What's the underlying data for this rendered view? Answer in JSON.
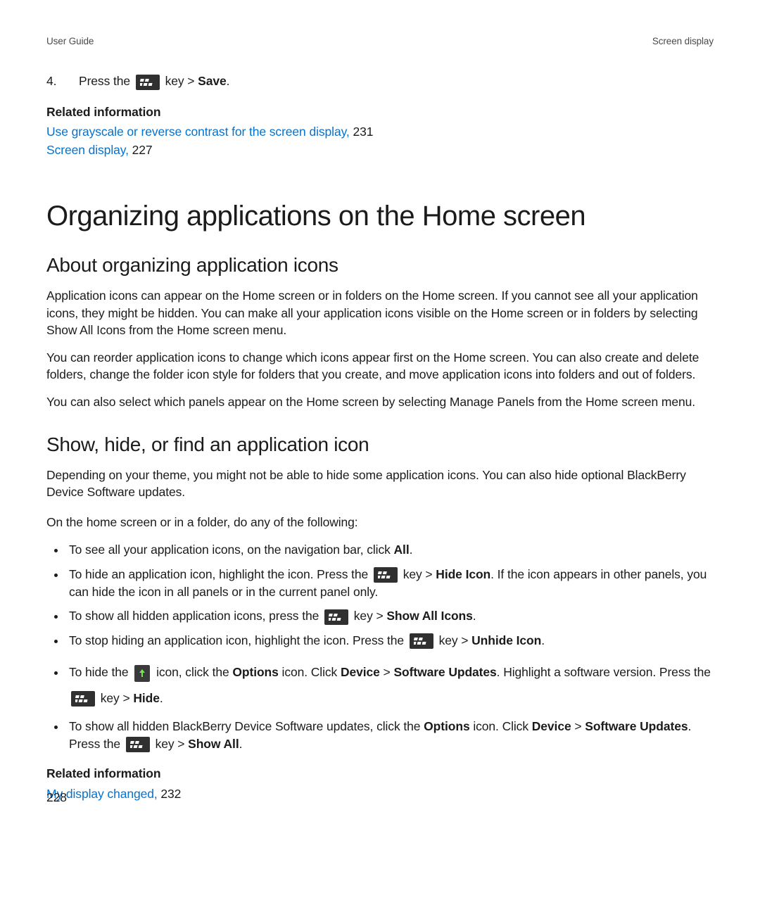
{
  "header": {
    "left": "User Guide",
    "right": "Screen display"
  },
  "step": {
    "number": "4.",
    "text_before_key": "Press the ",
    "text_after_key_prefix": " key > ",
    "bold": "Save",
    "period": "."
  },
  "related1": {
    "heading": "Related information",
    "links": [
      {
        "text": "Use grayscale or reverse contrast for the screen display,",
        "page": " 231"
      },
      {
        "text": "Screen display,",
        "page": " 227"
      }
    ]
  },
  "h1": "Organizing applications on the Home screen",
  "sectA": {
    "title": "About organizing application icons",
    "p1": "Application icons can appear on the Home screen or in folders on the Home screen. If you cannot see all your application icons, they might be hidden. You can make all your application icons visible on the Home screen or in folders by selecting Show All Icons from the Home screen menu.",
    "p2": "You can reorder application icons to change which icons appear first on the Home screen. You can also create and delete folders, change the folder icon style for folders that you create, and move application icons into folders and out of folders.",
    "p3": "You can also select which panels appear on the Home screen by selecting Manage Panels from the Home screen menu."
  },
  "sectB": {
    "title": "Show, hide, or find an application icon",
    "intro": "Depending on your theme, you might not be able to hide some application icons. You can also hide optional BlackBerry Device Software updates.",
    "lead": "On the home screen or in a folder, do any of the following:",
    "b1": {
      "pre": "To see all your application icons, on the navigation bar, click ",
      "b": "All",
      "post": "."
    },
    "b2": {
      "pre": "To hide an application icon, highlight the icon. Press the ",
      "mid": " key > ",
      "b": "Hide Icon",
      "post": ". If the icon appears in other panels, you can hide the icon in all panels or in the current panel only."
    },
    "b3": {
      "pre": "To show all hidden application icons, press the ",
      "mid": " key > ",
      "b": "Show All Icons",
      "post": "."
    },
    "b4": {
      "pre": "To stop hiding an application icon, highlight the icon. Press the ",
      "mid": " key > ",
      "b": "Unhide Icon",
      "post": "."
    },
    "b5": {
      "pre": "To hide the ",
      "mid1": " icon, click the ",
      "b1": "Options",
      "mid2": " icon. Click ",
      "b2": "Device",
      "gt1": " > ",
      "b3": "Software Updates",
      "mid3": ". Highlight a software version. Press the ",
      "mid4": " key > ",
      "b4": "Hide",
      "post": "."
    },
    "b6": {
      "pre": "To show all hidden BlackBerry Device Software updates, click the ",
      "b1": "Options",
      "mid1": " icon. Click ",
      "b2": "Device",
      "gt": " > ",
      "b3": "Software Updates",
      "mid2": ". Press the ",
      "mid3": " key > ",
      "b4": "Show All",
      "post": "."
    }
  },
  "related2": {
    "heading": "Related information",
    "links": [
      {
        "text": "My display changed,",
        "page": " 232"
      }
    ]
  },
  "footer_page": "228",
  "icons": {
    "bb_key": "blackberry-menu-key-icon",
    "update": "software-update-arrow-icon"
  }
}
